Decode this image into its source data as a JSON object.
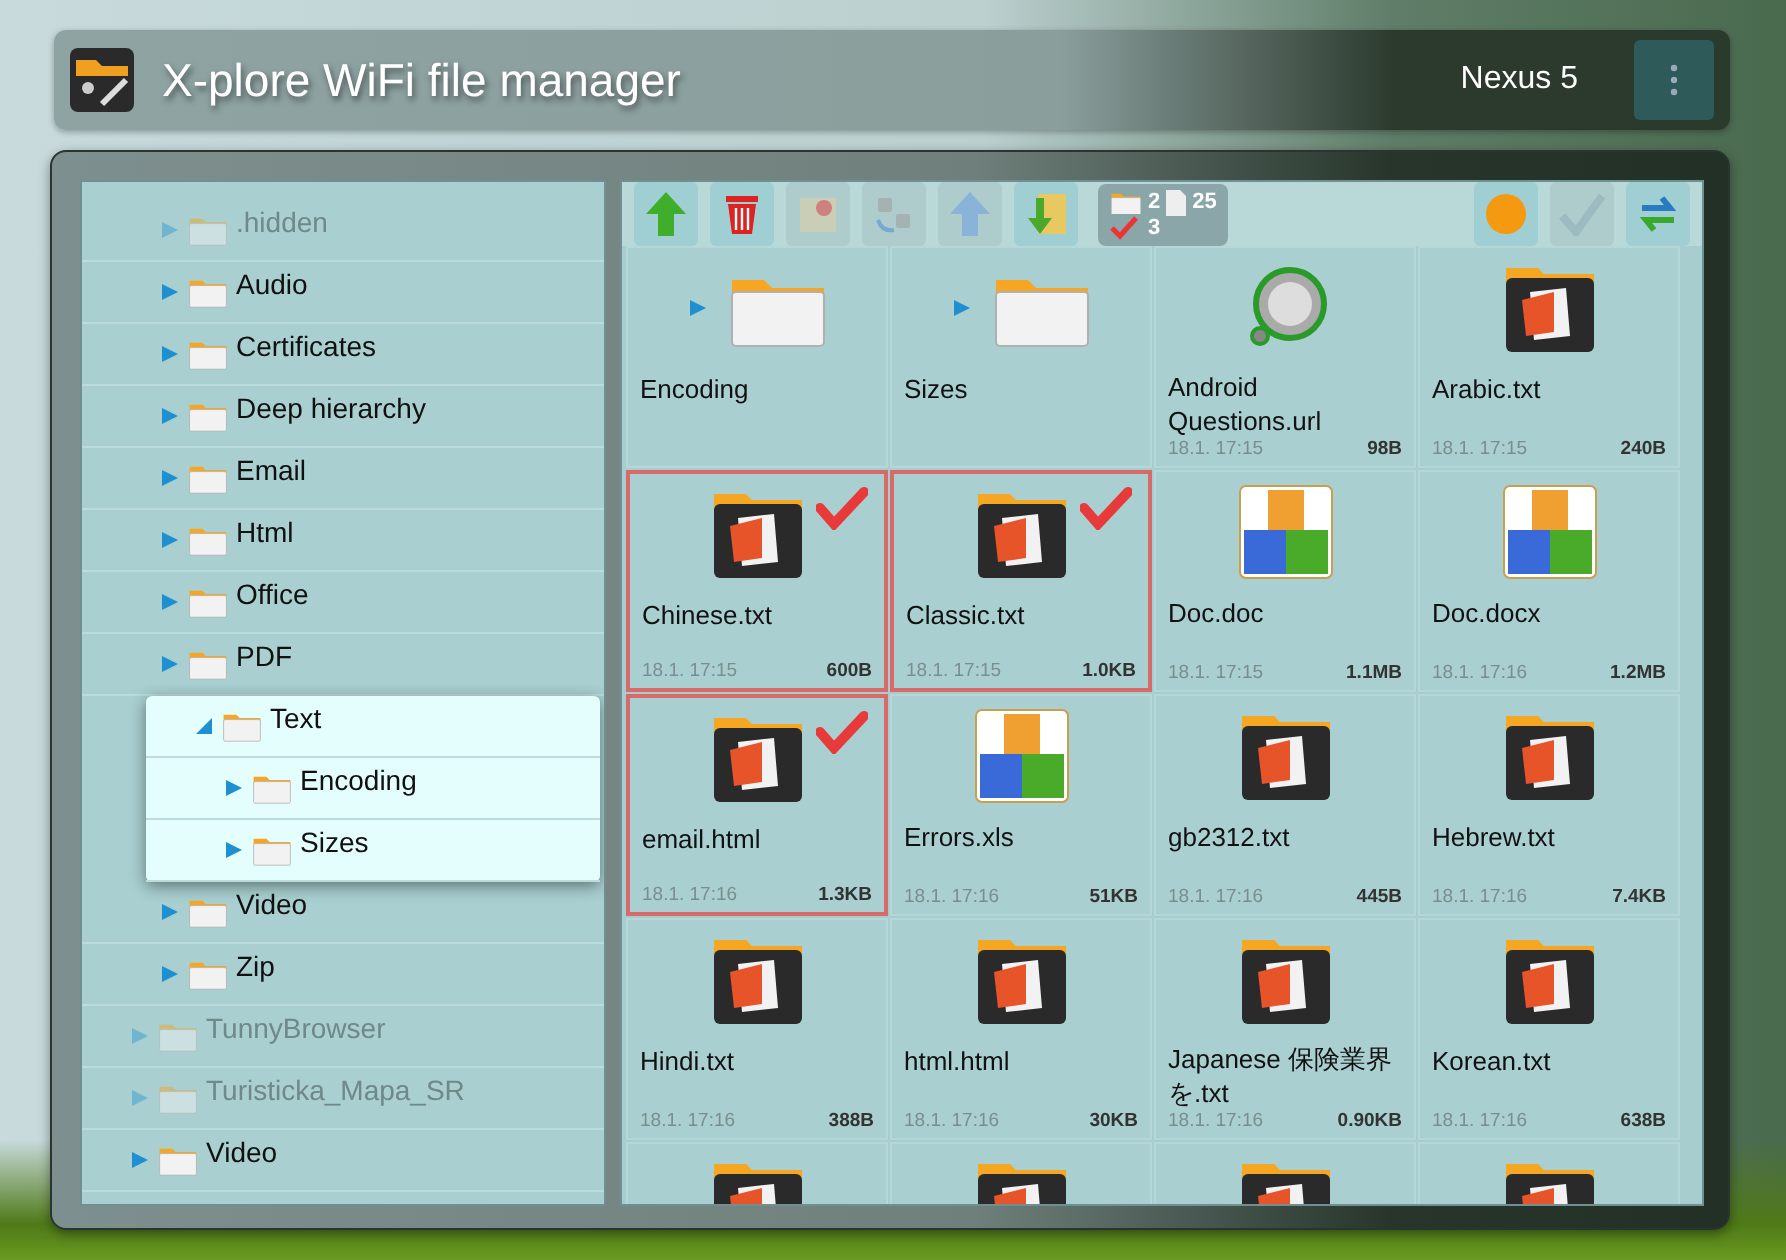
{
  "header": {
    "title": "X-plore WiFi file manager",
    "device": "Nexus 5"
  },
  "tree": [
    {
      "name": ".hidden",
      "dimmed": true,
      "expanded": false,
      "selected": false
    },
    {
      "name": "Audio",
      "dimmed": false,
      "expanded": false,
      "selected": false
    },
    {
      "name": "Certificates",
      "dimmed": false,
      "expanded": false,
      "selected": false
    },
    {
      "name": "Deep hierarchy",
      "dimmed": false,
      "expanded": false,
      "selected": false
    },
    {
      "name": "Email",
      "dimmed": false,
      "expanded": false,
      "selected": false
    },
    {
      "name": "Html",
      "dimmed": false,
      "expanded": false,
      "selected": false
    },
    {
      "name": "Office",
      "dimmed": false,
      "expanded": false,
      "selected": false
    },
    {
      "name": "PDF",
      "dimmed": false,
      "expanded": false,
      "selected": false
    },
    {
      "name": "Text",
      "dimmed": false,
      "expanded": true,
      "selected": true,
      "children": [
        {
          "name": "Encoding",
          "dimmed": false,
          "expanded": false,
          "selected": false
        },
        {
          "name": "Sizes",
          "dimmed": false,
          "expanded": false,
          "selected": false
        }
      ]
    },
    {
      "name": "Video",
      "dimmed": false,
      "expanded": false,
      "selected": false
    },
    {
      "name": "Zip",
      "dimmed": false,
      "expanded": false,
      "selected": false
    }
  ],
  "tree_after": [
    {
      "name": "TunnyBrowser",
      "dimmed": true,
      "expanded": false,
      "selected": false
    },
    {
      "name": "Turisticka_Mapa_SR",
      "dimmed": true,
      "expanded": false,
      "selected": false
    },
    {
      "name": "Video",
      "dimmed": false,
      "expanded": false,
      "selected": false
    }
  ],
  "toolbar": [
    {
      "kind": "up",
      "disabled": false
    },
    {
      "kind": "delete",
      "disabled": false
    },
    {
      "kind": "zip",
      "disabled": true
    },
    {
      "kind": "rename",
      "disabled": true
    },
    {
      "kind": "upload",
      "disabled": true
    },
    {
      "kind": "download",
      "disabled": false
    }
  ],
  "counter": {
    "folders": "2",
    "files": "25",
    "checked": "3"
  },
  "toolbar_right": [
    {
      "kind": "circle",
      "disabled": false
    },
    {
      "kind": "check",
      "disabled": true
    },
    {
      "kind": "sync",
      "disabled": false
    }
  ],
  "files": [
    {
      "kind": "folder",
      "name": "Encoding",
      "selected": false
    },
    {
      "kind": "folder",
      "name": "Sizes",
      "selected": false
    },
    {
      "kind": "url",
      "name": "Android Questions.url",
      "date": "18.1. 17:15",
      "size": "98B",
      "selected": false
    },
    {
      "kind": "text",
      "name": "Arabic.txt",
      "date": "18.1. 17:15",
      "size": "240B",
      "selected": false
    },
    {
      "kind": "text",
      "name": "Chinese.txt",
      "date": "18.1. 17:15",
      "size": "600B",
      "selected": true
    },
    {
      "kind": "text",
      "name": "Classic.txt",
      "date": "18.1. 17:15",
      "size": "1.0KB",
      "selected": true
    },
    {
      "kind": "office",
      "name": "Doc.doc",
      "date": "18.1. 17:15",
      "size": "1.1MB",
      "selected": false
    },
    {
      "kind": "office",
      "name": "Doc.docx",
      "date": "18.1. 17:16",
      "size": "1.2MB",
      "selected": false
    },
    {
      "kind": "text",
      "name": "email.html",
      "date": "18.1. 17:16",
      "size": "1.3KB",
      "selected": true
    },
    {
      "kind": "office",
      "name": "Errors.xls",
      "date": "18.1. 17:16",
      "size": "51KB",
      "selected": false
    },
    {
      "kind": "text",
      "name": "gb2312.txt",
      "date": "18.1. 17:16",
      "size": "445B",
      "selected": false
    },
    {
      "kind": "text",
      "name": "Hebrew.txt",
      "date": "18.1. 17:16",
      "size": "7.4KB",
      "selected": false
    },
    {
      "kind": "text",
      "name": "Hindi.txt",
      "date": "18.1. 17:16",
      "size": "388B",
      "selected": false
    },
    {
      "kind": "text",
      "name": "html.html",
      "date": "18.1. 17:16",
      "size": "30KB",
      "selected": false
    },
    {
      "kind": "text",
      "name": "Japanese 保険業界を.txt",
      "date": "18.1. 17:16",
      "size": "0.90KB",
      "selected": false
    },
    {
      "kind": "text",
      "name": "Korean.txt",
      "date": "18.1. 17:16",
      "size": "638B",
      "selected": false
    },
    {
      "kind": "text",
      "selected": false
    },
    {
      "kind": "text",
      "selected": false
    },
    {
      "kind": "text",
      "selected": false
    },
    {
      "kind": "text",
      "selected": false
    }
  ]
}
